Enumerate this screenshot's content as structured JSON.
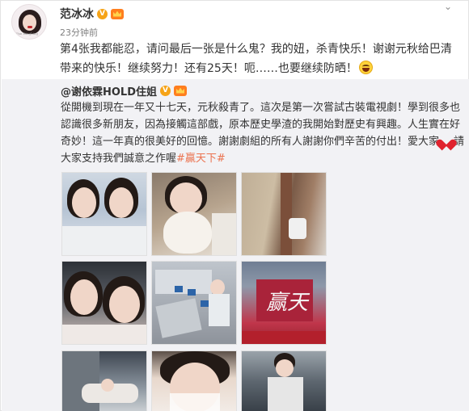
{
  "post": {
    "author": "范冰冰",
    "time": "23分钟前",
    "text": "第4张我都能忍，请问最后一张是什么鬼？我的妞，杀青快乐！谢谢元秋给巴清带来的快乐！继续努力！还有25天！呃……也要继续防晒！",
    "avatar_signature": "Fan Bingbing"
  },
  "repost": {
    "author": "@谢依霖HOLD住姐",
    "text_part1": "從開機到現在一年又十七天，元秋殺青了。這次是第一次嘗試古裝電視劇！學到很多也認識很多新朋友，因為接觸這部戲，原本歷史學渣的我開始對歷史有興趣。人生實在好奇妙！這一年真的很美好的回憶。謝謝劇組的所有人謝謝你們辛苦的付出！愛大家",
    "text_part2": "請大家支持我們誠意之作喔",
    "topic": "#贏天下#",
    "photo6_sign": "赢天"
  },
  "icons": {
    "verified": "verified-v-icon",
    "vip": "vip-crown-icon",
    "menu": "chevron-down-icon",
    "emoji": "laughing-tears-emoji-icon",
    "heart": "red-heart-icon"
  },
  "colors": {
    "topic": "#eb7350",
    "verified": "#f6a418",
    "repost_bg": "#f2f2f5"
  }
}
